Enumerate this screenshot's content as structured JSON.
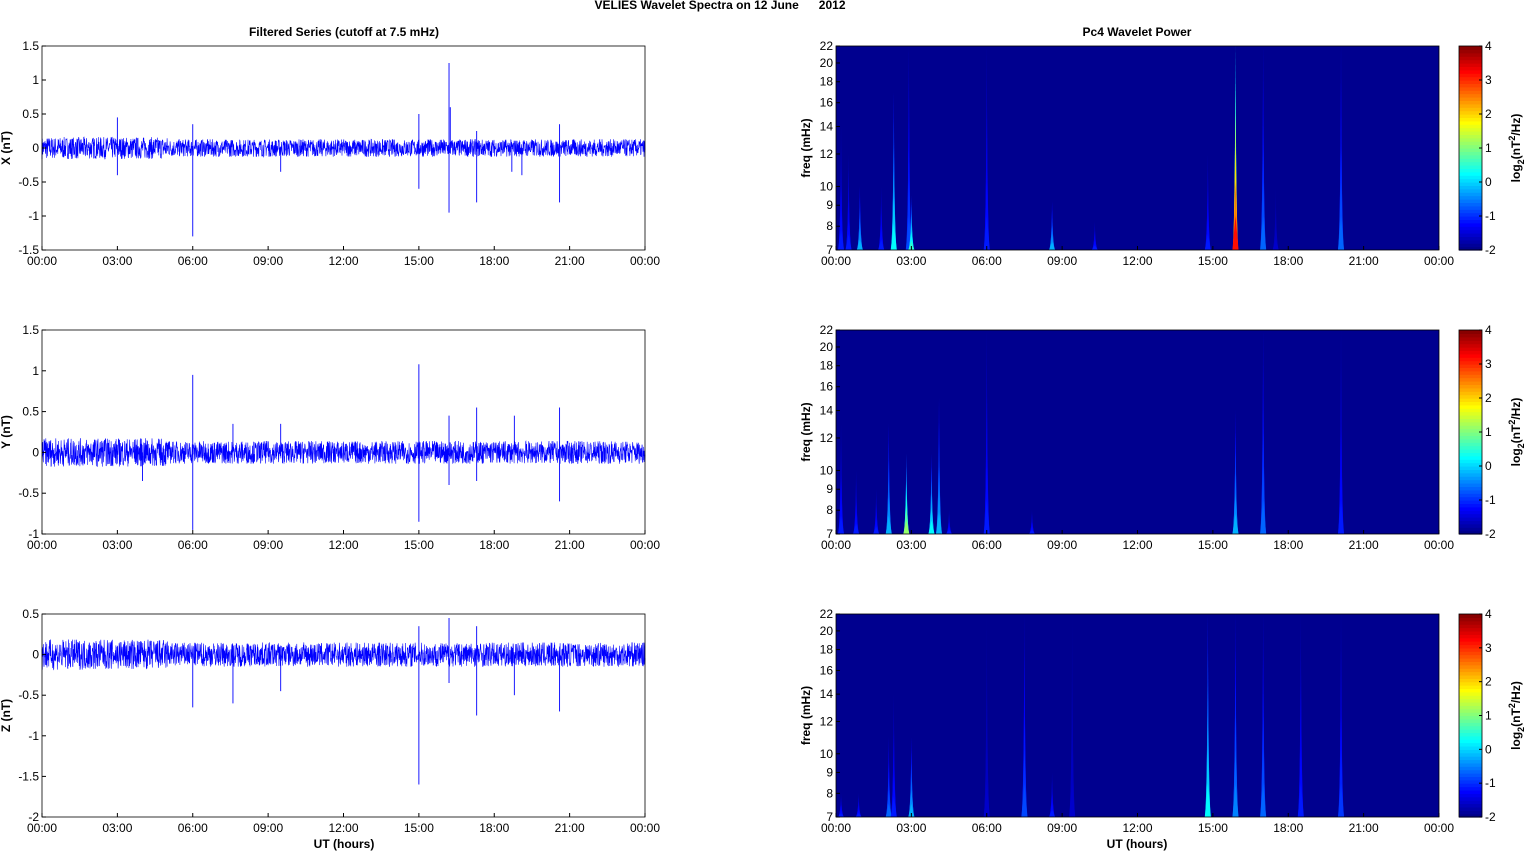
{
  "title": "VELIES Wavelet Spectra on 12 June      2012",
  "left_title": "Filtered Series (cutoff at 7.5 mHz)",
  "right_title": "Pc4 Wavelet Power",
  "xlabel": "UT (hours)",
  "freq_label": "freq (mHz)",
  "cbar_label": "log2(nT2/Hz)",
  "colors": {
    "trace": "#0000ff",
    "background": "#00008f"
  },
  "chart_data": [
    {
      "type": "line",
      "name": "X",
      "ylabel": "X (nT)",
      "ylim": [
        -1.5,
        1.5
      ],
      "yticks": [
        -1.5,
        -1,
        -0.5,
        0,
        0.5,
        1,
        1.5
      ],
      "xticks": [
        "00:00",
        "03:00",
        "06:00",
        "09:00",
        "12:00",
        "15:00",
        "18:00",
        "21:00",
        "00:00"
      ],
      "xlim": [
        0,
        24
      ],
      "noise": 0.13,
      "spikes": [
        [
          3.0,
          0.45
        ],
        [
          3.0,
          -0.4
        ],
        [
          6.0,
          -1.3
        ],
        [
          6.0,
          0.35
        ],
        [
          15.0,
          0.5
        ],
        [
          15.0,
          -0.6
        ],
        [
          16.2,
          1.25
        ],
        [
          16.2,
          -0.95
        ],
        [
          16.25,
          0.6
        ],
        [
          17.3,
          -0.8
        ],
        [
          17.3,
          0.25
        ],
        [
          18.7,
          -0.35
        ],
        [
          19.1,
          -0.4
        ],
        [
          20.6,
          -0.8
        ],
        [
          20.6,
          0.35
        ],
        [
          9.5,
          -0.35
        ]
      ]
    },
    {
      "type": "line",
      "name": "Y",
      "ylabel": "Y (nT)",
      "ylim": [
        -1,
        1.5
      ],
      "yticks": [
        -1,
        -0.5,
        0,
        0.5,
        1,
        1.5
      ],
      "xticks": [
        "00:00",
        "03:00",
        "06:00",
        "09:00",
        "12:00",
        "15:00",
        "18:00",
        "21:00",
        "00:00"
      ],
      "xlim": [
        0,
        24
      ],
      "noise": 0.14,
      "spikes": [
        [
          6.0,
          0.95
        ],
        [
          6.0,
          -0.95
        ],
        [
          15.0,
          1.08
        ],
        [
          15.0,
          -0.85
        ],
        [
          16.2,
          0.45
        ],
        [
          16.2,
          -0.4
        ],
        [
          17.3,
          0.55
        ],
        [
          17.3,
          -0.35
        ],
        [
          18.8,
          0.45
        ],
        [
          20.6,
          0.55
        ],
        [
          20.6,
          -0.6
        ],
        [
          7.6,
          0.35
        ],
        [
          9.5,
          0.35
        ],
        [
          4.0,
          -0.35
        ]
      ]
    },
    {
      "type": "line",
      "name": "Z",
      "ylabel": "Z (nT)",
      "ylim": [
        -2,
        0.5
      ],
      "yticks": [
        -2,
        -1.5,
        -1,
        -0.5,
        0,
        0.5
      ],
      "xticks": [
        "00:00",
        "03:00",
        "06:00",
        "09:00",
        "12:00",
        "15:00",
        "18:00",
        "21:00",
        "00:00"
      ],
      "xlim": [
        0,
        24
      ],
      "noise": 0.15,
      "spikes": [
        [
          6.0,
          -0.65
        ],
        [
          7.6,
          -0.6
        ],
        [
          9.5,
          -0.45
        ],
        [
          15.0,
          -1.6
        ],
        [
          15.0,
          0.35
        ],
        [
          16.2,
          -0.35
        ],
        [
          16.2,
          0.45
        ],
        [
          17.3,
          -0.75
        ],
        [
          17.3,
          0.35
        ],
        [
          18.8,
          -0.5
        ],
        [
          20.6,
          -0.7
        ]
      ]
    },
    {
      "type": "heatmap",
      "name": "X power",
      "ylabel": "freq (mHz)",
      "ylim": [
        7,
        22
      ],
      "yticks": [
        7,
        8,
        9,
        10,
        12,
        14,
        16,
        18,
        20,
        22
      ],
      "clim": [
        -2,
        4
      ],
      "cticks": [
        -2,
        -1,
        0,
        1,
        2,
        3,
        4
      ],
      "xticks": [
        "00:00",
        "03:00",
        "06:00",
        "09:00",
        "12:00",
        "15:00",
        "18:00",
        "21:00",
        "00:00"
      ],
      "xlim": [
        0,
        24
      ],
      "events": [
        [
          0.2,
          14,
          -1
        ],
        [
          0.5,
          12,
          -1
        ],
        [
          0.95,
          10,
          0
        ],
        [
          1.8,
          10,
          -1
        ],
        [
          2.3,
          17,
          0.5
        ],
        [
          2.9,
          22,
          -0.7
        ],
        [
          3.0,
          9.5,
          0.8
        ],
        [
          6.0,
          22,
          -1
        ],
        [
          8.6,
          9.2,
          0
        ],
        [
          10.3,
          8.2,
          -1
        ],
        [
          14.8,
          12,
          -1
        ],
        [
          15.9,
          22,
          3.8
        ],
        [
          17.0,
          22,
          -0.5
        ],
        [
          17.5,
          10,
          -1.5
        ],
        [
          20.1,
          22,
          -0.5
        ]
      ]
    },
    {
      "type": "heatmap",
      "name": "Y power",
      "ylabel": "freq (mHz)",
      "ylim": [
        7,
        22
      ],
      "yticks": [
        7,
        8,
        9,
        10,
        12,
        14,
        16,
        18,
        20,
        22
      ],
      "clim": [
        -2,
        4
      ],
      "cticks": [
        -2,
        -1,
        0,
        1,
        2,
        3,
        4
      ],
      "xticks": [
        "00:00",
        "03:00",
        "06:00",
        "09:00",
        "12:00",
        "15:00",
        "18:00",
        "21:00",
        "00:00"
      ],
      "xlim": [
        0,
        24
      ],
      "events": [
        [
          0.2,
          13,
          -1
        ],
        [
          0.8,
          10,
          -1
        ],
        [
          1.6,
          9,
          -1
        ],
        [
          2.1,
          13,
          0
        ],
        [
          2.8,
          11,
          1.5
        ],
        [
          3.8,
          11,
          0.5
        ],
        [
          4.1,
          15,
          0
        ],
        [
          4.5,
          8,
          -1
        ],
        [
          6.0,
          22,
          -1
        ],
        [
          7.8,
          8,
          -1
        ],
        [
          15.9,
          14,
          0
        ],
        [
          17.0,
          22,
          -0.5
        ],
        [
          20.1,
          22,
          -1
        ]
      ]
    },
    {
      "type": "heatmap",
      "name": "Z power",
      "ylabel": "freq (mHz)",
      "ylim": [
        7,
        22
      ],
      "yticks": [
        7,
        8,
        9,
        10,
        12,
        14,
        16,
        18,
        20,
        22
      ],
      "clim": [
        -2,
        4
      ],
      "cticks": [
        -2,
        -1,
        0,
        1,
        2,
        3,
        4
      ],
      "xticks": [
        "00:00",
        "03:00",
        "06:00",
        "09:00",
        "12:00",
        "15:00",
        "18:00",
        "21:00",
        "00:00"
      ],
      "xlim": [
        0,
        24
      ],
      "events": [
        [
          0.2,
          8,
          -1
        ],
        [
          0.9,
          8,
          -1
        ],
        [
          2.1,
          11,
          -0.5
        ],
        [
          2.3,
          14,
          -1
        ],
        [
          3.0,
          11,
          0
        ],
        [
          6.0,
          22,
          -1.5
        ],
        [
          7.5,
          22,
          -0.7
        ],
        [
          8.6,
          9,
          -1
        ],
        [
          9.4,
          22,
          -1.5
        ],
        [
          14.8,
          22,
          0.5
        ],
        [
          15.9,
          22,
          -0.3
        ],
        [
          17.0,
          22,
          -0.5
        ],
        [
          18.5,
          22,
          -1
        ],
        [
          20.1,
          22,
          -0.8
        ]
      ]
    }
  ]
}
